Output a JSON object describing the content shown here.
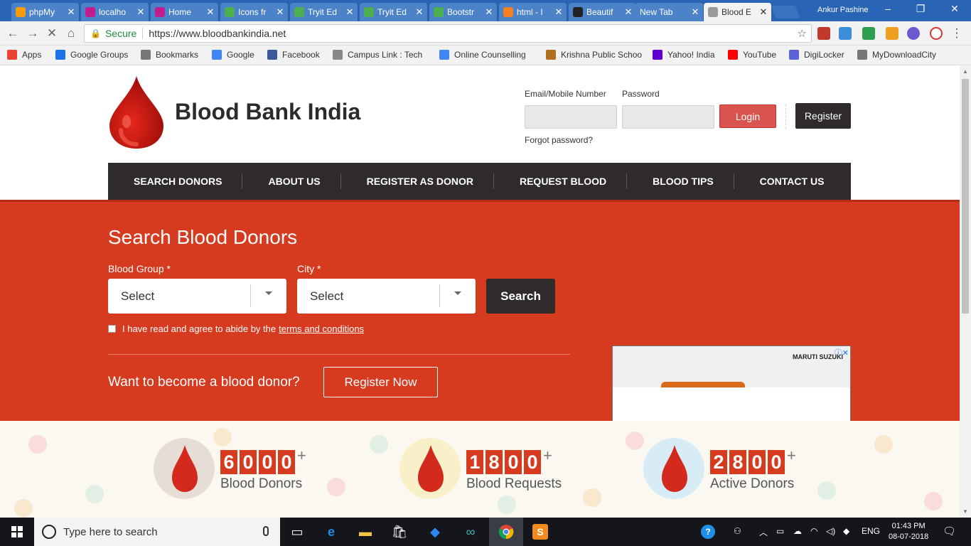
{
  "browser": {
    "tabs": [
      {
        "title": "phpMy",
        "icon": "phpmyadmin-icon",
        "color": "#f89c0e"
      },
      {
        "title": "localho",
        "icon": "xampp-icon",
        "color": "#c21c8e"
      },
      {
        "title": "Home",
        "icon": "xampp-icon",
        "color": "#c21c8e"
      },
      {
        "title": "Icons fr",
        "icon": "w3schools-icon",
        "color": "#4caf50"
      },
      {
        "title": "Tryit Ed",
        "icon": "w3schools-icon",
        "color": "#4caf50"
      },
      {
        "title": "Tryit Ed",
        "icon": "w3schools-icon",
        "color": "#4caf50"
      },
      {
        "title": "Bootstr",
        "icon": "w3schools-icon",
        "color": "#4caf50"
      },
      {
        "title": "html - I",
        "icon": "stackoverflow-icon",
        "color": "#f48024"
      },
      {
        "title": "Beautif",
        "icon": "codepen-icon",
        "color": "#222222"
      },
      {
        "title": "New Tab",
        "icon": "",
        "color": ""
      },
      {
        "title": "Blood E",
        "icon": "loading-icon",
        "color": "#999999"
      }
    ],
    "profile_name": "Ankur Pashine",
    "secure_label": "Secure",
    "url": "https://www.bloodbankindia.net",
    "bookmarks": [
      {
        "label": "Apps",
        "icon": "apps-grid-icon"
      },
      {
        "label": "Google Groups",
        "icon": "google-groups-icon"
      },
      {
        "label": "Bookmarks",
        "icon": "star-icon"
      },
      {
        "label": "Google",
        "icon": "google-icon"
      },
      {
        "label": "Facebook",
        "icon": "facebook-icon"
      },
      {
        "label": "Campus Link : Tech",
        "icon": "page-icon"
      },
      {
        "label": "Online Counselling",
        "icon": "google-icon"
      },
      {
        "label": "Krishna Public Schoo",
        "icon": "school-crest-icon"
      },
      {
        "label": "Yahoo! India",
        "icon": "yahoo-icon"
      },
      {
        "label": "YouTube",
        "icon": "youtube-icon"
      },
      {
        "label": "DigiLocker",
        "icon": "digilocker-icon"
      },
      {
        "label": "MyDownloadCity",
        "icon": "mydownloadcity-icon"
      }
    ]
  },
  "site": {
    "brand": "Blood Bank India",
    "login": {
      "email_label": "Email/Mobile Number",
      "password_label": "Password",
      "login_button": "Login",
      "register_button": "Register",
      "forgot": "Forgot password?"
    },
    "nav": [
      "SEARCH DONORS",
      "ABOUT US",
      "REGISTER AS DONOR",
      "REQUEST BLOOD",
      "BLOOD TIPS",
      "CONTACT US"
    ],
    "search": {
      "title": "Search Blood Donors",
      "blood_group_label": "Blood Group *",
      "blood_group_value": "Select",
      "city_label": "City *",
      "city_value": "Select",
      "search_button": "Search",
      "agree_text": "I have read and agree to abide by the",
      "terms_link": "terms and conditions",
      "cta_text": "Want to become a blood donor?",
      "cta_button": "Register Now"
    },
    "ad": {
      "brand": "MARUTI SUZUKI",
      "close": "ⓘ✕"
    },
    "stats": [
      {
        "digits": [
          "6",
          "0",
          "0",
          "0"
        ],
        "plus": "+",
        "label": "Blood Donors",
        "icon": "thumbs-up-blood-drop-icon"
      },
      {
        "digits": [
          "1",
          "8",
          "0",
          "0"
        ],
        "plus": "+",
        "label": "Blood Requests",
        "icon": "hand-blood-drop-icon"
      },
      {
        "digits": [
          "2",
          "8",
          "0",
          "0"
        ],
        "plus": "+",
        "label": "Active Donors",
        "icon": "donor-group-blood-drop-icon"
      }
    ],
    "colors": {
      "primary_red": "#d63a1f",
      "dark": "#2f2b2a",
      "login_red": "#d9534f"
    }
  },
  "taskbar": {
    "search_placeholder": "Type here to search",
    "language": "ENG",
    "time": "01:43 PM",
    "date": "08-07-2018"
  }
}
